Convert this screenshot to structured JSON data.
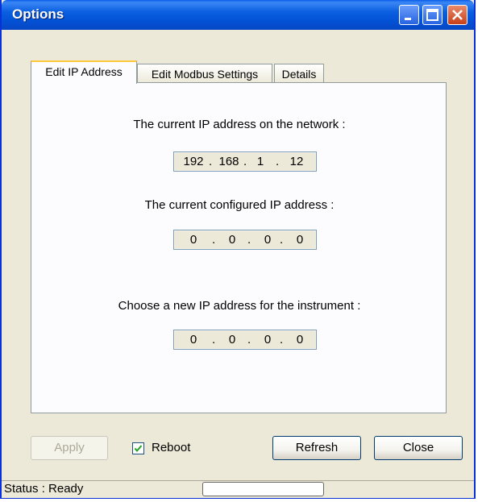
{
  "window": {
    "title": "Options"
  },
  "tabs": [
    {
      "label": "Edit IP Address",
      "active": true
    },
    {
      "label": "Edit Modbus Settings",
      "active": false
    },
    {
      "label": "Details",
      "active": false
    }
  ],
  "sections": {
    "current_ip": {
      "label": "The current IP address on the network :",
      "octets": [
        "192",
        "168",
        "1",
        "12"
      ]
    },
    "configured_ip": {
      "label": "The current configured IP address :",
      "octets": [
        "0",
        "0",
        "0",
        "0"
      ]
    },
    "new_ip": {
      "label": "Choose a new IP address for the instrument :",
      "octets": [
        "0",
        "0",
        "0",
        "0"
      ]
    }
  },
  "buttons": {
    "apply": "Apply",
    "refresh": "Refresh",
    "close": "Close"
  },
  "reboot": {
    "label": "Reboot",
    "checked": true
  },
  "status": {
    "text": "Status : Ready"
  },
  "icons": [
    "minimize-icon",
    "maximize-icon",
    "close-icon",
    "checkmark-icon"
  ],
  "colors": {
    "titlebar": "#0a5fe0",
    "face": "#ece9d8",
    "tab_highlight": "#ffc83c"
  }
}
